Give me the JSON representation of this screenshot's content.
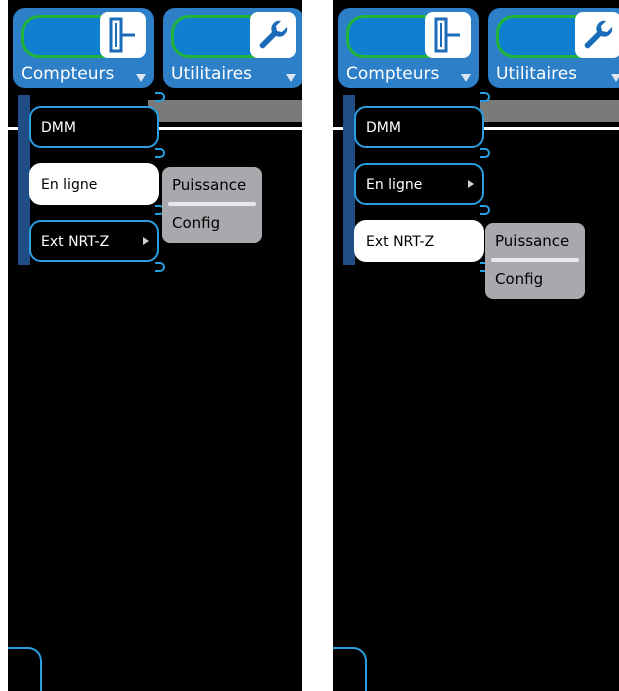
{
  "screens": [
    {
      "tabs": [
        {
          "label": "Compteurs",
          "icon": "meter-probe-icon"
        },
        {
          "label": "Utilitaires",
          "icon": "wrench-icon"
        }
      ],
      "menu": [
        {
          "label": "DMM",
          "has_submenu": false,
          "selected": false
        },
        {
          "label": "En ligne",
          "has_submenu": true,
          "selected": true
        },
        {
          "label": "Ext NRT-Z",
          "has_submenu": true,
          "selected": false
        }
      ],
      "submenu": [
        "Puissance",
        "Config"
      ]
    },
    {
      "tabs": [
        {
          "label": "Compteurs",
          "icon": "meter-probe-icon"
        },
        {
          "label": "Utilitaires",
          "icon": "wrench-icon"
        }
      ],
      "menu": [
        {
          "label": "DMM",
          "has_submenu": false,
          "selected": false
        },
        {
          "label": "En ligne",
          "has_submenu": true,
          "selected": false
        },
        {
          "label": "Ext NRT-Z",
          "has_submenu": true,
          "selected": true
        }
      ],
      "submenu": [
        "Puissance",
        "Config"
      ]
    }
  ],
  "colors": {
    "tab_blue": "#2d7fc8",
    "border_blue": "#2a9ee0",
    "pill_green": "#21b43a",
    "submenu_gray": "#a9a9ad"
  }
}
